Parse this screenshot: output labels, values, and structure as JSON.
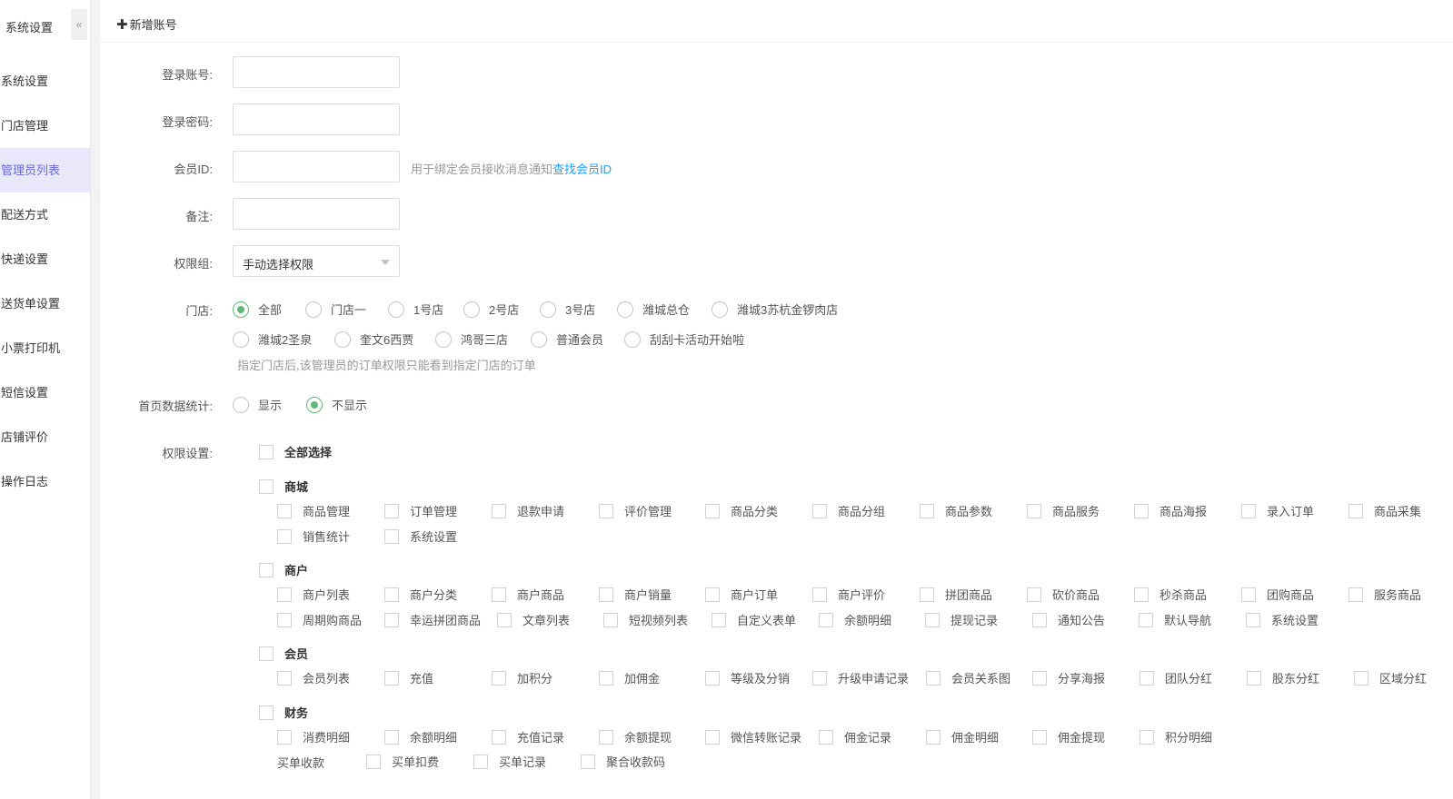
{
  "sidebar": {
    "title": "系统设置",
    "collapse_icon": "«",
    "items": [
      {
        "label": "系统设置",
        "active": false
      },
      {
        "label": "门店管理",
        "active": false
      },
      {
        "label": "管理员列表",
        "active": true
      },
      {
        "label": "配送方式",
        "active": false
      },
      {
        "label": "快递设置",
        "active": false
      },
      {
        "label": "送货单设置",
        "active": false
      },
      {
        "label": "小票打印机",
        "active": false
      },
      {
        "label": "短信设置",
        "active": false
      },
      {
        "label": "店铺评价",
        "active": false
      },
      {
        "label": "操作日志",
        "active": false
      }
    ]
  },
  "header": {
    "add_icon": "✚",
    "add_label": "新增账号"
  },
  "form": {
    "account": {
      "label": "登录账号:",
      "value": ""
    },
    "password": {
      "label": "登录密码:",
      "value": ""
    },
    "member_id": {
      "label": "会员ID:",
      "value": "",
      "hint": "用于绑定会员接收消息通知",
      "link": "查找会员ID"
    },
    "remark": {
      "label": "备注:",
      "value": ""
    },
    "perm_group": {
      "label": "权限组:",
      "selected": "手动选择权限"
    },
    "stores": {
      "label": "门店:",
      "options": [
        "全部",
        "门店一",
        "1号店",
        "2号店",
        "3号店",
        "潍城总仓",
        "潍城3苏杭金锣肉店",
        "潍城2圣泉",
        "奎文6西贾",
        "鸿哥三店",
        "普通会员",
        "刮刮卡活动开始啦"
      ],
      "selected_index": 0,
      "hint": "指定门店后,该管理员的订单权限只能看到指定门店的订单"
    },
    "home_stats": {
      "label": "首页数据统计:",
      "options": [
        "显示",
        "不显示"
      ],
      "selected_index": 1
    },
    "permissions": {
      "label": "权限设置:",
      "select_all": "全部选择",
      "groups": [
        {
          "name": "商城",
          "items": [
            "商品管理",
            "订单管理",
            "退款申请",
            "评价管理",
            "商品分类",
            "商品分组",
            "商品参数",
            "商品服务",
            "商品海报",
            "录入订单",
            "商品采集",
            "销售统计",
            "系统设置"
          ]
        },
        {
          "name": "商户",
          "items": [
            "商户列表",
            "商户分类",
            "商户商品",
            "商户销量",
            "商户订单",
            "商户评价",
            "拼团商品",
            "砍价商品",
            "秒杀商品",
            "团购商品",
            "服务商品",
            "周期购商品",
            "幸运拼团商品",
            "文章列表",
            "短视频列表",
            "自定义表单",
            "余额明细",
            "提现记录",
            "通知公告",
            "默认导航",
            "系统设置"
          ]
        },
        {
          "name": "会员",
          "items": [
            "会员列表",
            "充值",
            "加积分",
            "加佣金",
            "等级及分销",
            "升级申请记录",
            "会员关系图",
            "分享海报",
            "团队分红",
            "股东分红",
            "区域分红"
          ]
        },
        {
          "name": "财务",
          "items": [
            "消费明细",
            "余额明细",
            "充值记录",
            "余额提现",
            "微信转账记录",
            "佣金记录",
            "佣金明细",
            "佣金提现",
            "积分明细"
          ],
          "sub_label": "买单收款",
          "sub_items": [
            "买单扣费",
            "买单记录",
            "聚合收款码"
          ]
        }
      ]
    }
  },
  "colors": {
    "accent_green": "#5fb878",
    "link_blue": "#1e9fff",
    "active_menu_bg": "#e8e8fa",
    "active_menu_text": "#6a6ad9"
  }
}
